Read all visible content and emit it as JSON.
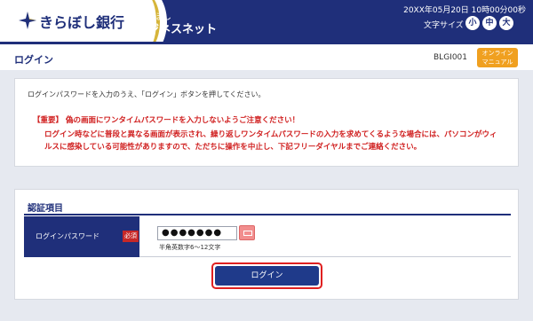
{
  "header": {
    "bank_name": "きらぼし銀行",
    "service_sub": "きらぼし",
    "service_name": "ビジネスネット",
    "datetime": "20XX年05月20日 10時00分00秒",
    "font_size_label": "文字サイズ",
    "font_sizes": {
      "small": "小",
      "medium": "中",
      "large": "大"
    }
  },
  "titlebar": {
    "title": "ログイン",
    "screen_id": "BLGI001",
    "manual_line1": "オンライン",
    "manual_line2": "マニュアル"
  },
  "notice": {
    "instruction": "ログインパスワードを入力のうえ、「ログイン」ボタンを押してください。",
    "warning_head": "【重要】 偽の画面にワンタイムパスワードを入力しないようご注意ください！",
    "warning_body": "ログイン時などに普段と異なる画面が表示され、繰り返しワンタイムパスワードの入力を求めてくるような場合には、パソコンがウィルスに感染している可能性がありますので、ただちに操作を中止し、下記フリーダイヤルまでご連絡ください。"
  },
  "auth": {
    "section_title": "認証項目",
    "field_label": "ログインパスワード",
    "required": "必須",
    "password_value": "●●●●●●●",
    "hint": "半角英数字6～12文字",
    "login_label": "ログイン"
  },
  "colors": {
    "brand_navy": "#1f2f7a",
    "accent_gold": "#d6b53a",
    "warning_red": "#d02020",
    "manual_orange": "#f0a020"
  }
}
